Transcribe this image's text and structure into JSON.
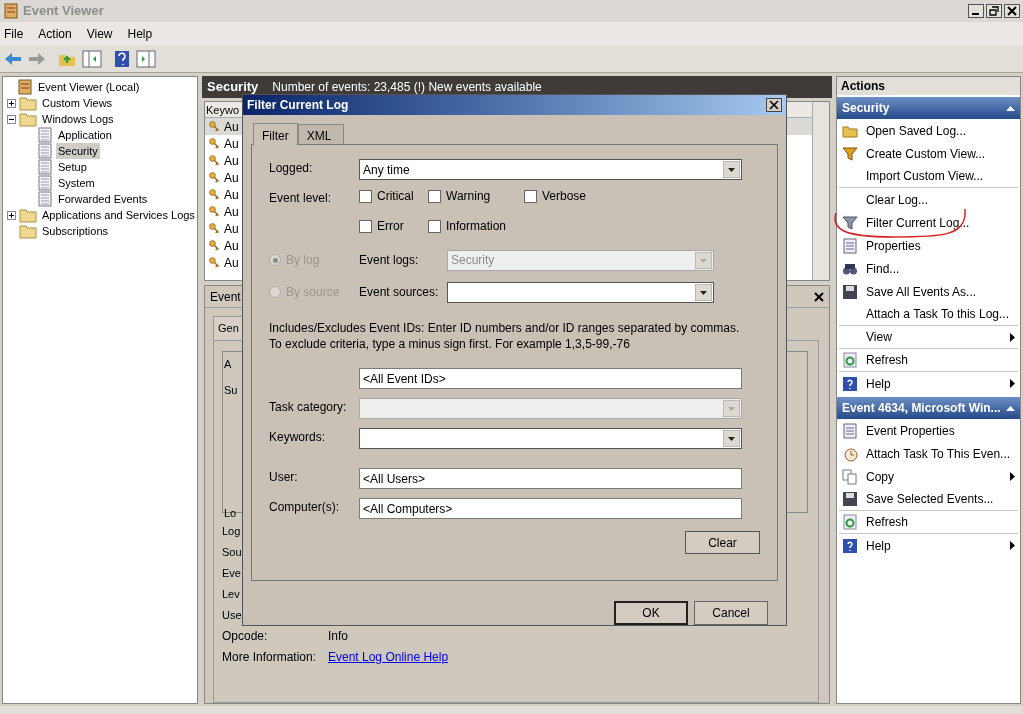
{
  "window": {
    "title": "Event Viewer"
  },
  "menu": [
    "File",
    "Action",
    "View",
    "Help"
  ],
  "tree": [
    {
      "label": "Event Viewer (Local)",
      "kind": "root",
      "selected": false,
      "children": [
        {
          "label": "Custom Views",
          "kind": "folder",
          "selected": false,
          "expanded": false
        },
        {
          "label": "Windows Logs",
          "kind": "folder",
          "selected": false,
          "expanded": true,
          "children": [
            {
              "label": "Application",
              "kind": "log",
              "selected": false
            },
            {
              "label": "Security",
              "kind": "log",
              "selected": true
            },
            {
              "label": "Setup",
              "kind": "log",
              "selected": false
            },
            {
              "label": "System",
              "kind": "log",
              "selected": false
            },
            {
              "label": "Forwarded Events",
              "kind": "log",
              "selected": false
            }
          ]
        },
        {
          "label": "Applications and Services Logs",
          "kind": "folder",
          "selected": false,
          "expanded": false
        },
        {
          "label": "Subscriptions",
          "kind": "folder",
          "selected": false
        }
      ]
    }
  ],
  "log_header": {
    "title": "Security",
    "summary": "Number of events: 23,485 (!) New events available"
  },
  "events": {
    "column": "Keywo",
    "rows": [
      {
        "cell": "Au",
        "selected": true
      },
      {
        "cell": "Au",
        "selected": false
      },
      {
        "cell": "Au",
        "selected": false
      },
      {
        "cell": "Au",
        "selected": false
      },
      {
        "cell": "Au",
        "selected": false
      },
      {
        "cell": "Au",
        "selected": false
      },
      {
        "cell": "Au",
        "selected": false
      },
      {
        "cell": "Au",
        "selected": false
      },
      {
        "cell": "Au",
        "selected": false
      }
    ]
  },
  "event_detail": {
    "title": "Event",
    "tab": "Gen",
    "box_lines": [
      "A",
      "Su",
      "Lo"
    ],
    "fields": [
      "Log",
      "Sou",
      "Eve",
      "Lev",
      "Use"
    ],
    "opcode": {
      "label": "Opcode:",
      "value": "Info"
    },
    "more_info": {
      "label": "More Information:",
      "link": "Event Log Online Help"
    }
  },
  "dialog": {
    "title": "Filter Current Log",
    "tabs": [
      {
        "label": "Filter",
        "selected": true
      },
      {
        "label": "XML",
        "selected": false
      }
    ],
    "logged": {
      "label": "Logged:",
      "value": "Any time"
    },
    "event_level": {
      "label": "Event level:",
      "options": [
        {
          "label": "Critical",
          "checked": false
        },
        {
          "label": "Warning",
          "checked": false
        },
        {
          "label": "Verbose",
          "checked": false
        },
        {
          "label": "Error",
          "checked": false
        },
        {
          "label": "Information",
          "checked": false
        }
      ]
    },
    "sources": [
      {
        "option": "By log",
        "selected": true,
        "disabled": true,
        "label": "Event logs:",
        "value": "Security",
        "field_disabled": true
      },
      {
        "option": "By source",
        "selected": false,
        "disabled": true,
        "label": "Event sources:",
        "field_disabled": false
      }
    ],
    "description": "Includes/Excludes Event IDs: Enter ID numbers and/or ID ranges separated by commas. To exclude criteria, type a minus sign first. For example 1,3,5-99,-76",
    "filters": [
      {
        "kind": "input",
        "value": "<All Event IDs>"
      },
      {
        "kind": "dropdown",
        "label": "Task category:",
        "disabled": true
      },
      {
        "kind": "dropdown",
        "label": "Keywords:",
        "disabled": false
      },
      {
        "kind": "input",
        "label": "User:",
        "value": "<All Users>"
      },
      {
        "kind": "input",
        "label": "Computer(s):",
        "value": "<All Computers>"
      }
    ],
    "clear": "Clear",
    "buttons": [
      "OK",
      "Cancel"
    ]
  },
  "actions": {
    "title": "Actions",
    "sections": [
      {
        "title": "Security",
        "items": [
          {
            "label": "Open Saved Log...",
            "kind": "folder"
          },
          {
            "label": "Create Custom View...",
            "kind": "funnel"
          },
          {
            "label": "Import Custom View...",
            "kind": "none",
            "divider_after": true
          },
          {
            "label": "Clear Log...",
            "kind": "none"
          },
          {
            "label": "Filter Current Log...",
            "kind": "filter",
            "annotated": true
          },
          {
            "label": "Properties",
            "kind": "properties"
          },
          {
            "label": "Find...",
            "kind": "find"
          },
          {
            "label": "Save All Events As...",
            "kind": "save"
          },
          {
            "label": "Attach a Task To this Log...",
            "kind": "none",
            "divider_after": true
          },
          {
            "label": "View",
            "kind": "none",
            "submenu": true,
            "divider_after": true
          },
          {
            "label": "Refresh",
            "kind": "refresh",
            "divider_after": true
          },
          {
            "label": "Help",
            "kind": "help",
            "submenu": true
          }
        ]
      },
      {
        "title": "Event 4634, Microsoft Win...",
        "items": [
          {
            "label": "Event Properties",
            "kind": "properties"
          },
          {
            "label": "Attach Task To This Even...",
            "kind": "task"
          },
          {
            "label": "Copy",
            "kind": "copy",
            "submenu": true
          },
          {
            "label": "Save Selected Events...",
            "kind": "save",
            "divider_after": true
          },
          {
            "label": "Refresh",
            "kind": "refresh",
            "divider_after": true
          },
          {
            "label": "Help",
            "kind": "help",
            "submenu": true
          }
        ]
      }
    ]
  }
}
